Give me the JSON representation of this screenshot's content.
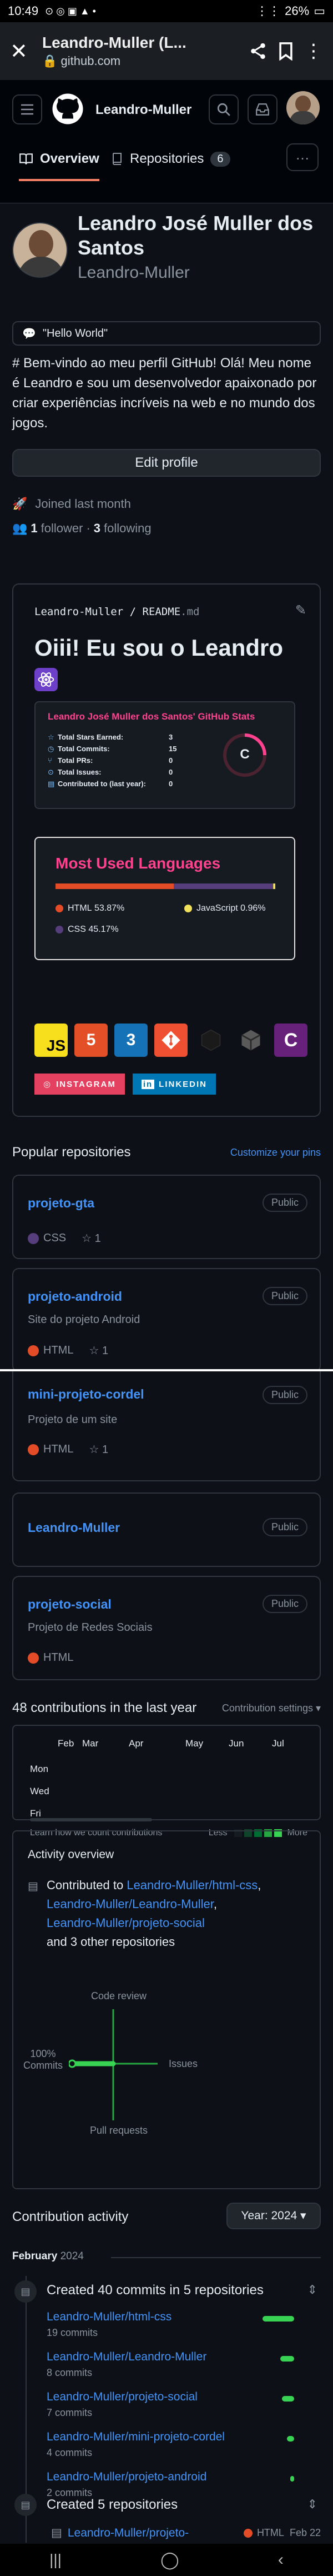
{
  "status": {
    "time": "10:49",
    "battery": "26%"
  },
  "browser": {
    "title": "Leandro-Muller (L...",
    "url": "github.com"
  },
  "header": {
    "username": "Leandro-Muller"
  },
  "tabs": [
    {
      "label": "Overview"
    },
    {
      "label": "Repositories",
      "count": "6"
    }
  ],
  "profile": {
    "name": "Leandro José Muller dos Santos",
    "login": "Leandro-Muller",
    "status": "\"Hello World\"",
    "bio": "# Bem-vindo ao meu perfil GitHub! Olá! Meu nome é Leandro e sou um desenvolvedor apaixonado por criar experiências incríveis na web e no mundo dos jogos.",
    "edit_button": "Edit profile",
    "joined": "Joined last month",
    "followers_count": "1",
    "followers_label": "follower",
    "following_count": "3",
    "following_label": "following"
  },
  "readme": {
    "path_user": "Leandro-Muller",
    "path_sep": "/",
    "path_file": "README",
    "path_ext": ".md",
    "heading": "Oiii! Eu sou o Leandro",
    "stats": {
      "title": "Leandro José Muller dos Santos' GitHub Stats",
      "rows": [
        {
          "label": "Total Stars Earned:",
          "value": "3"
        },
        {
          "label": "Total Commits:",
          "value": "15"
        },
        {
          "label": "Total PRs:",
          "value": "0"
        },
        {
          "label": "Total Issues:",
          "value": "0"
        },
        {
          "label": "Contributed to (last year):",
          "value": "0"
        }
      ],
      "grade": "C"
    },
    "languages": {
      "title": "Most Used Languages",
      "items": [
        {
          "name": "HTML",
          "percent": "53.87%",
          "color": "#e34c26",
          "value": 53.87
        },
        {
          "name": "JavaScript",
          "percent": "0.96%",
          "color": "#f1e05a",
          "value": 0.96
        },
        {
          "name": "CSS",
          "percent": "45.17%",
          "color": "#563d7c",
          "value": 45.17
        }
      ]
    },
    "tech_icons": [
      "JS",
      "5",
      "3",
      "git-icon",
      "unity-icon",
      "cube-icon",
      "C"
    ],
    "instagram": "INSTAGRAM",
    "linkedin": "LINKEDIN"
  },
  "popular": {
    "title": "Popular repositories",
    "customize": "Customize your pins",
    "repos": [
      {
        "name": "projeto-gta",
        "visibility": "Public",
        "desc": "",
        "lang": "CSS",
        "lang_color": "#563d7c",
        "stars": "1"
      },
      {
        "name": "projeto-android",
        "visibility": "Public",
        "desc": "Site do projeto Android",
        "lang": "HTML",
        "lang_color": "#e34c26",
        "stars": "1"
      },
      {
        "name": "mini-projeto-cordel",
        "visibility": "Public",
        "desc": "Projeto de um site",
        "lang": "HTML",
        "lang_color": "#e34c26",
        "stars": "1"
      },
      {
        "name": "Leandro-Muller",
        "visibility": "Public",
        "desc": "",
        "lang": "",
        "lang_color": "",
        "stars": ""
      },
      {
        "name": "projeto-social",
        "visibility": "Public",
        "desc": "Projeto de Redes Sociais",
        "lang": "HTML",
        "lang_color": "#e34c26",
        "stars": ""
      }
    ]
  },
  "contrib": {
    "title": "48 contributions in the last year",
    "settings": "Contribution settings",
    "months": [
      "Feb",
      "Mar",
      "Apr",
      "May",
      "Jun",
      "Jul"
    ],
    "days": [
      "Mon",
      "Wed",
      "Fri"
    ],
    "learn": "Learn how we count contributions",
    "less": "Less",
    "more": "More"
  },
  "activity_overview": {
    "title": "Activity overview",
    "contributed_to": "Contributed to",
    "repo1": "Leandro-Muller/html-css",
    "repo2": "Leandro-Muller/Leandro-Muller",
    "repo3": "Leandro-Muller/projeto-social",
    "others": "and 3 other repositories",
    "axis_top": "Code review",
    "axis_left": "100%\nCommits",
    "axis_right": "Issues",
    "axis_bottom": "Pull requests"
  },
  "contribution_activity": {
    "title": "Contribution activity",
    "year_button": "Year: 2024",
    "month": "February",
    "year": "2024",
    "commits_title": "Created 40 commits in 5 repositories",
    "commit_repos": [
      {
        "name": "Leandro-Muller/html-css",
        "count": "19 commits",
        "bar": 0.95
      },
      {
        "name": "Leandro-Muller/Leandro-Muller",
        "count": "8 commits",
        "bar": 0.42
      },
      {
        "name": "Leandro-Muller/projeto-social",
        "count": "7 commits",
        "bar": 0.37
      },
      {
        "name": "Leandro-Muller/mini-projeto-cordel",
        "count": "4 commits",
        "bar": 0.21
      },
      {
        "name": "Leandro-Muller/projeto-android",
        "count": "2 commits",
        "bar": 0.11
      }
    ],
    "created_title": "Created 5 repositories",
    "created_repo": "Leandro-Muller/projeto-",
    "created_lang": "HTML",
    "created_date": "Feb 22"
  }
}
